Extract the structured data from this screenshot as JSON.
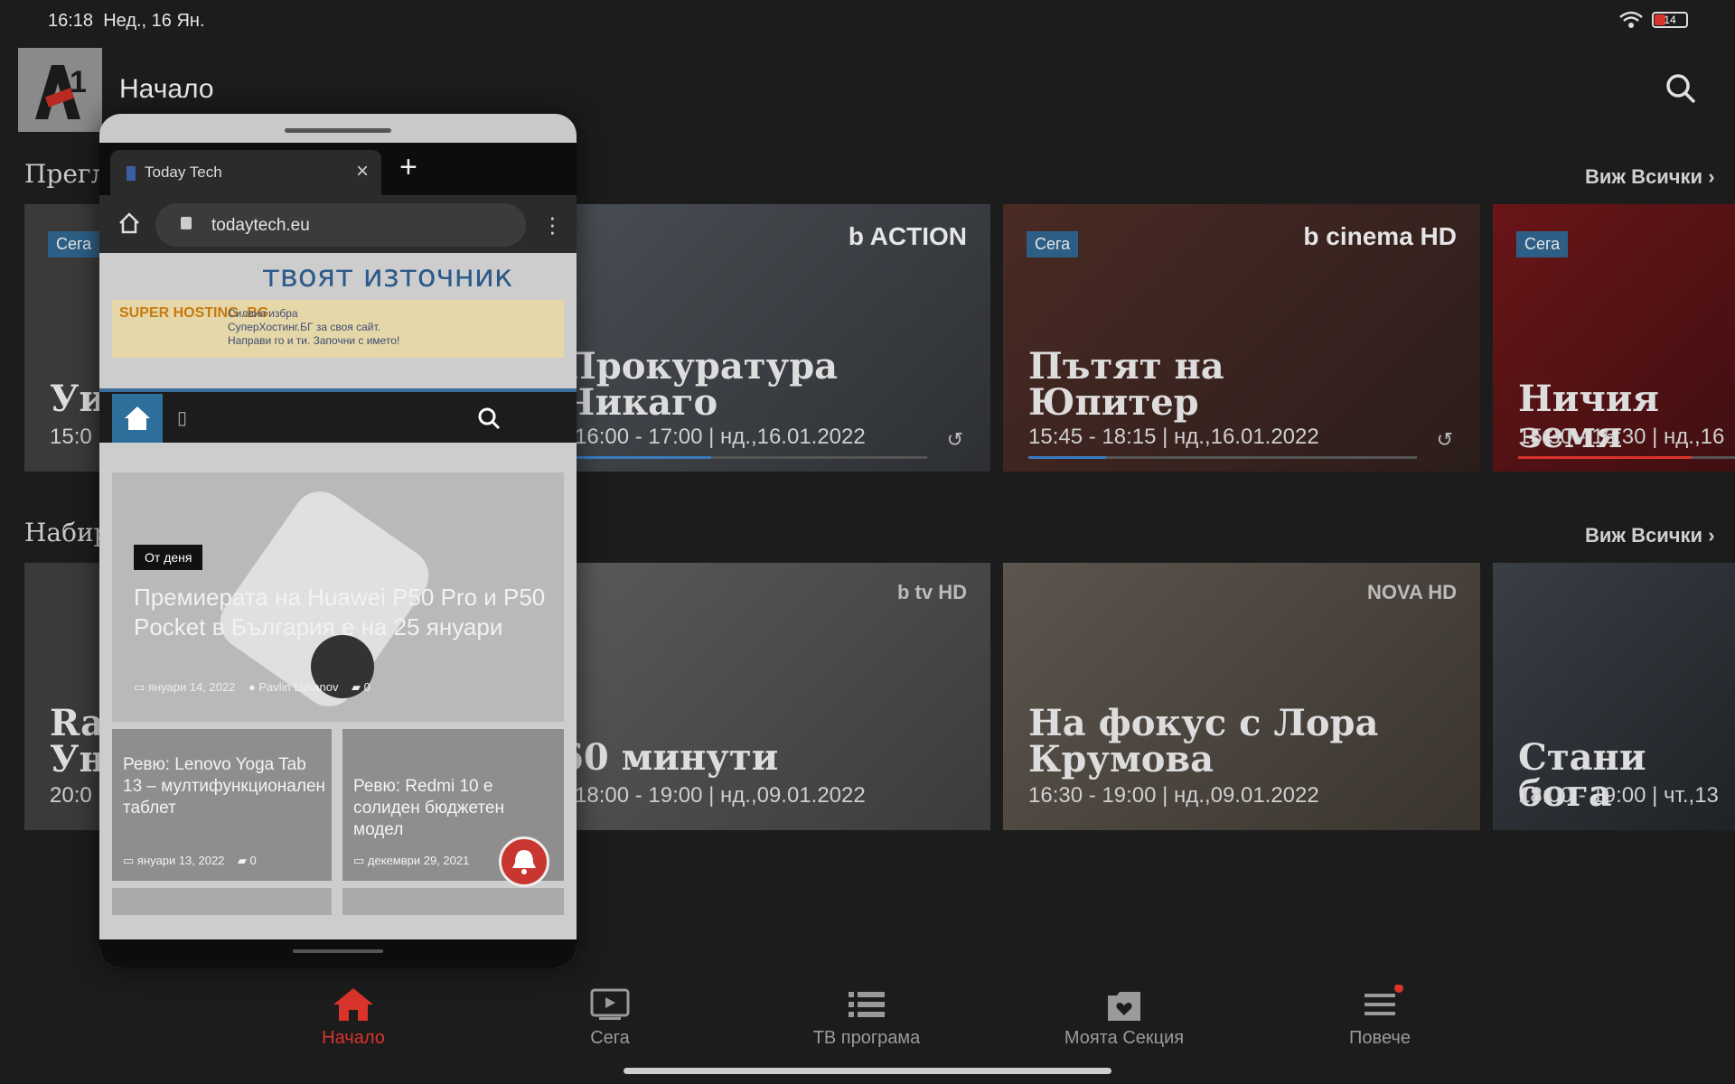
{
  "status": {
    "time": "16:18",
    "date": "Нед., 16 Ян.",
    "battery": "14"
  },
  "app": {
    "title": "Начало",
    "logo_text": "A1"
  },
  "sections": [
    {
      "title": "Преглед",
      "see_all": "Виж Всички"
    },
    {
      "title": "Набир",
      "see_all": "Виж Всички"
    }
  ],
  "live_cards": [
    {
      "badge": "Сега",
      "title": "Уи",
      "time": "15:0",
      "channel": "",
      "progress": 0
    },
    {
      "badge": "Сега",
      "title": "Прокуратура\nЧикаго",
      "time": "16:00 - 17:00 | нд.,16.01.2022",
      "channel": "b ACTION",
      "progress": 0.4
    },
    {
      "badge": "Сега",
      "title": "Пътят на\nЮпитер",
      "time": "15:45 - 18:15 | нд.,16.01.2022",
      "channel": "b cinema HD",
      "progress": 0.2
    },
    {
      "badge": "Сега",
      "title": "Ничия земя",
      "time": "15:30 - 16:30 | нд.,16",
      "channel": "",
      "progress": 0.8
    }
  ],
  "vod_cards": [
    {
      "title": "Ra\nУн",
      "time": "20:0",
      "channel": ""
    },
    {
      "title": "60 минути",
      "time": "18:00 - 19:00 | нд.,09.01.2022",
      "channel": "b tv HD"
    },
    {
      "title": "На фокус с Лора\nКрумова",
      "time": "16:30 - 19:00 | нд.,09.01.2022",
      "channel": "NOVA HD"
    },
    {
      "title": "Стани бога",
      "time": "18:00 - 19:00 | чт.,13",
      "channel": ""
    }
  ],
  "nav": [
    {
      "label": "Начало",
      "icon": "home-icon",
      "active": true
    },
    {
      "label": "Сега",
      "icon": "tv-icon"
    },
    {
      "label": "ТВ програма",
      "icon": "list-icon"
    },
    {
      "label": "Моята Секция",
      "icon": "folder-heart-icon"
    },
    {
      "label": "Повече",
      "icon": "menu-icon"
    }
  ],
  "browser": {
    "tab_title": "Today Tech",
    "url": "todaytech.eu",
    "banner_tagline": "твоят източник",
    "ad": {
      "brand": "SUPER HOSTING .BG",
      "line1": "Силвия избра",
      "line2": "СуперХостинг.БГ за своя сайт.",
      "line3": "Направи го и ти. Започни с името!"
    },
    "hero": {
      "badge": "От деня",
      "title": "Премиерата на Huawei P50 Pro и P50 Pocket в България е на 25 януари",
      "date": "януари 14, 2022",
      "author": "Pavlin Lukanov",
      "comments": "0"
    },
    "minis": [
      {
        "title": "Ревю: Lenovo Yoga Tab 13 – мултифункционален таблет",
        "date": "януари 13, 2022",
        "comments": "0"
      },
      {
        "title": "Ревю: Redmi 10 е солиден бюджетен модел",
        "date": "декември 29, 2021",
        "comments": ""
      }
    ]
  },
  "colors": {
    "accent": "#d9342b",
    "badge": "#2d5f86",
    "progress": "#3a7bbf"
  }
}
